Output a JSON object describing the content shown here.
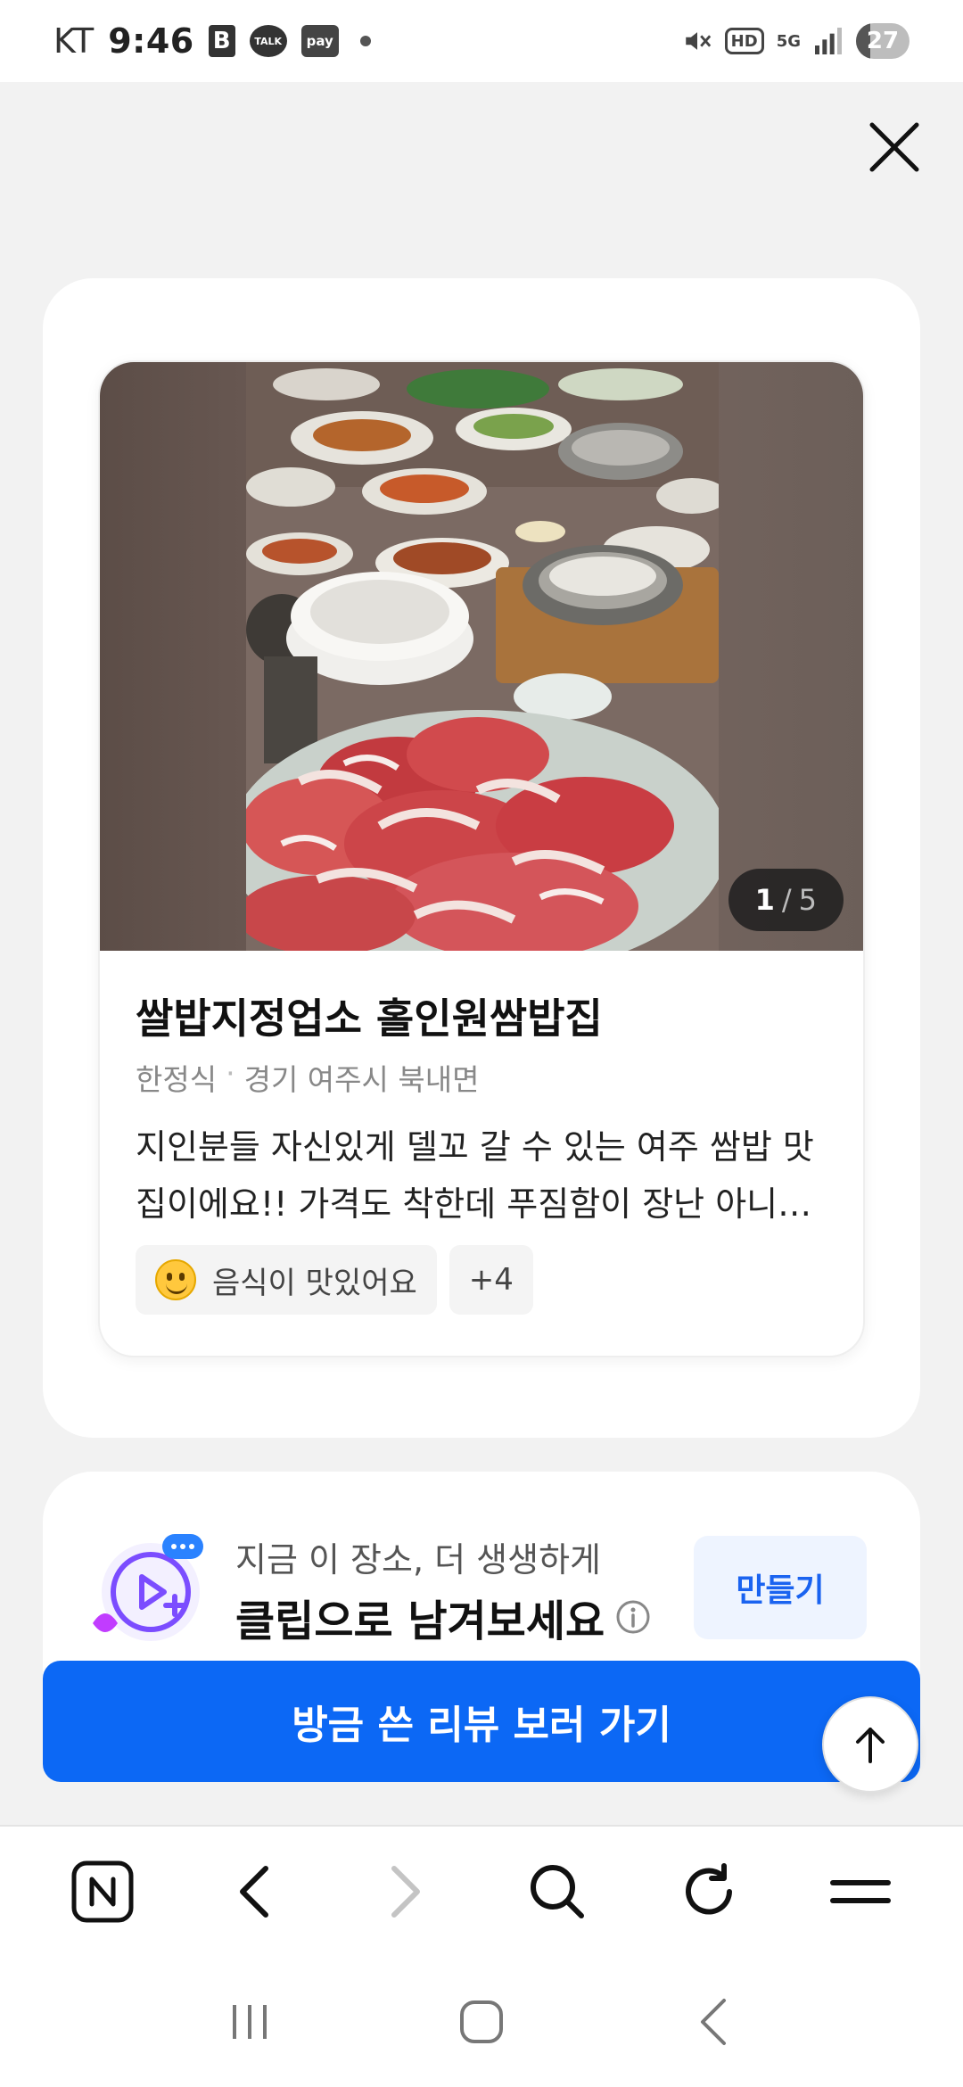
{
  "status_bar": {
    "carrier": "KT",
    "time": "9:46",
    "badge_b": "B",
    "talk_label": "TALK",
    "pay_label": "pay",
    "hd_label": "HD",
    "network_label": "5G",
    "battery_level": "27"
  },
  "review": {
    "photo_counter": {
      "current": "1",
      "separator": "/",
      "total": "5"
    },
    "place_name": "쌀밥지정업소 홀인원쌈밥집",
    "category": "한정식",
    "meta_separator": "·",
    "location": "경기 여주시 북내면",
    "text": "지인분들 자신있게 델꼬 갈 수 있는 여주 쌈밥 맛집이에요!! 가격도 착한데 푸짐함이 장난 아니에요",
    "tags": [
      {
        "label": "음식이 맛있어요",
        "icon": "smile-emoji-icon"
      },
      {
        "label": "+4"
      }
    ]
  },
  "clip": {
    "subtitle": "지금 이 장소, 더 생생하게",
    "title": "클립으로 남겨보세요",
    "make_button": "만들기"
  },
  "cta": {
    "label": "방금 쓴 리뷰 보러 가기"
  },
  "browser_toolbar": [
    "naver-home-icon",
    "back-arrow-icon",
    "forward-arrow-icon",
    "search-icon",
    "refresh-icon",
    "menu-icon"
  ],
  "colors": {
    "primary": "#0c68f5",
    "accent_light": "#eef4ff",
    "clip_purple": "#7b4dff"
  }
}
